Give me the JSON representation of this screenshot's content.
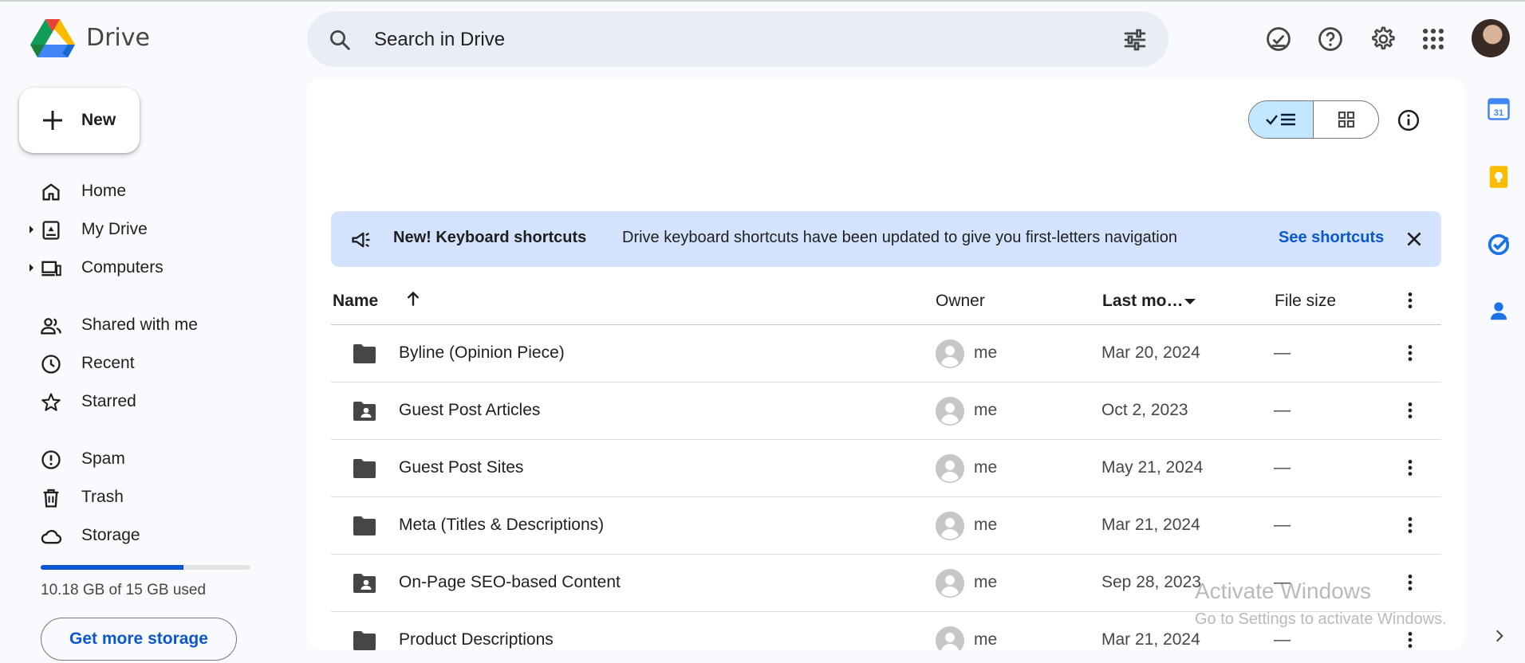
{
  "header": {
    "app_name": "Drive",
    "search_placeholder": "Search in Drive"
  },
  "sidebar": {
    "new_label": "New",
    "items": [
      {
        "label": "Home"
      },
      {
        "label": "My Drive"
      },
      {
        "label": "Computers"
      },
      {
        "label": "Shared with me"
      },
      {
        "label": "Recent"
      },
      {
        "label": "Starred"
      },
      {
        "label": "Spam"
      },
      {
        "label": "Trash"
      },
      {
        "label": "Storage"
      }
    ],
    "storage_used_fraction": 0.679,
    "storage_text": "10.18 GB of 15 GB used",
    "get_storage_label": "Get more storage"
  },
  "banner": {
    "title": "New! Keyboard shortcuts",
    "text": "Drive keyboard shortcuts have been updated to give you first-letters navigation",
    "link": "See shortcuts"
  },
  "table": {
    "columns": {
      "name": "Name",
      "owner": "Owner",
      "modified": "Last mo…",
      "size": "File size"
    },
    "rows": [
      {
        "name": "Byline (Opinion Piece)",
        "type": "folder",
        "owner": "me",
        "modified": "Mar 20, 2024",
        "size": "—"
      },
      {
        "name": "Guest Post Articles",
        "type": "shared-folder",
        "owner": "me",
        "modified": "Oct 2, 2023",
        "size": "—"
      },
      {
        "name": "Guest Post Sites",
        "type": "folder",
        "owner": "me",
        "modified": "May 21, 2024",
        "size": "—"
      },
      {
        "name": "Meta (Titles & Descriptions)",
        "type": "folder",
        "owner": "me",
        "modified": "Mar 21, 2024",
        "size": "—"
      },
      {
        "name": "On-Page SEO-based Content",
        "type": "shared-folder",
        "owner": "me",
        "modified": "Sep 28, 2023",
        "size": "—"
      },
      {
        "name": "Product Descriptions",
        "type": "folder",
        "owner": "me",
        "modified": "Mar 21, 2024",
        "size": "—"
      }
    ]
  },
  "watermark": {
    "line1": "Activate Windows",
    "line2": "Go to Settings to activate Windows."
  },
  "colors": {
    "accent": "#0b57d0",
    "banner_bg": "#d3e3fd",
    "toggle_active": "#c2e7ff",
    "page_bg": "#f8fafd"
  }
}
